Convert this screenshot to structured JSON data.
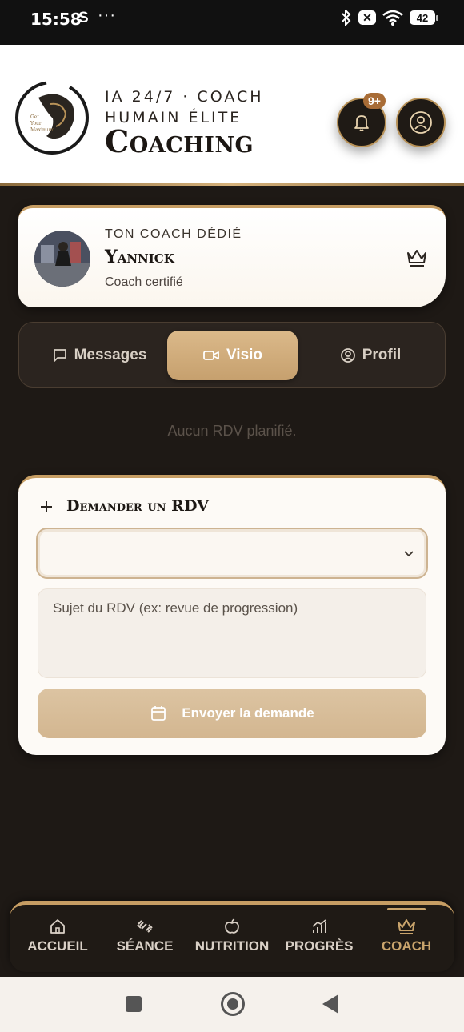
{
  "status_bar": {
    "time": "15:58",
    "s_icon": "S",
    "dots": "···",
    "x_label": "✕",
    "battery": "42"
  },
  "header": {
    "tagline": "IA 24/7 · COACH HUMAIN ÉLITE",
    "brand": "Coaching",
    "notification_badge": "9+",
    "logo_text": [
      "Get",
      "Your",
      "Maximum"
    ]
  },
  "coach_card": {
    "label": "TON COACH DÉDIÉ",
    "name": "Yannick",
    "subtitle": "Coach certifié"
  },
  "tabs": [
    {
      "label": "Messages",
      "icon": "message-icon",
      "active": false
    },
    {
      "label": "Visio",
      "icon": "video-icon",
      "active": true
    },
    {
      "label": "Profil",
      "icon": "user-circle-icon",
      "active": false
    }
  ],
  "empty_state": "Aucun RDV planifié.",
  "request_form": {
    "title": "Demander un RDV",
    "select_value": "",
    "subject_placeholder": "Sujet du RDV (ex: revue de progression)",
    "submit_label": "Envoyer la demande"
  },
  "bottom_nav": [
    {
      "label": "ACCUEIL",
      "icon": "home-icon",
      "active": false
    },
    {
      "label": "SÉANCE",
      "icon": "dumbbell-icon",
      "active": false
    },
    {
      "label": "NUTRITION",
      "icon": "apple-icon",
      "active": false
    },
    {
      "label": "PROGRÈS",
      "icon": "chart-icon",
      "active": false
    },
    {
      "label": "COACH",
      "icon": "crown-icon",
      "active": true
    }
  ],
  "colors": {
    "accent": "#c69d63",
    "dark": "#1e1915",
    "active_tab": "#d3b183"
  }
}
